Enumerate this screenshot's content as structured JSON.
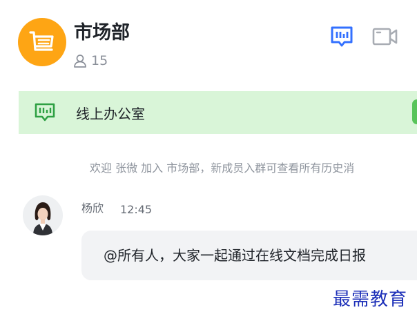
{
  "header": {
    "group_name": "市场部",
    "member_count": "15",
    "avatar_icon": "shopping-cart-icon",
    "avatar_color": "#fea514",
    "actions": {
      "office_icon": "online-office-icon",
      "video_icon": "video-camera-icon"
    }
  },
  "banner": {
    "label": "线上办公室",
    "icon": "online-office-icon",
    "background": "#d9f5d8",
    "accent": "#58c45a"
  },
  "system_message": "欢迎 张微 加入 市场部，新成员入群可查看所有历史消",
  "message": {
    "sender": "杨欣",
    "time": "12:45",
    "text": "@所有人，大家一起通过在线文档完成日报"
  },
  "watermark": "最需教育"
}
